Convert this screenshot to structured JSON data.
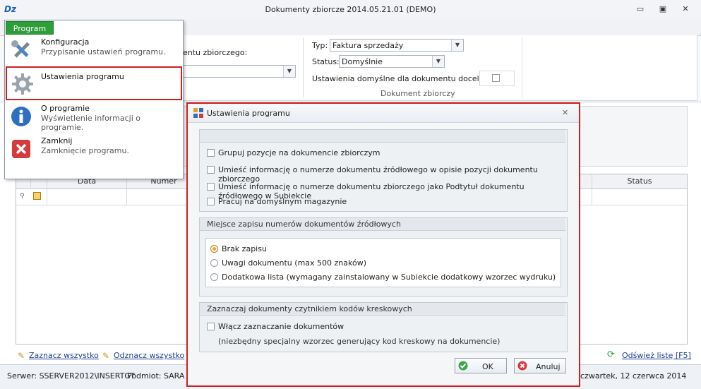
{
  "window": {
    "logo": "Dz",
    "title": "Dokumenty zbiorcze 2014.05.21.01 (DEMO)",
    "min_label": "▭",
    "restore_label": "▣",
    "close_label": "✕"
  },
  "ribbon": {
    "partial_label": "entu zbiorczego:",
    "typ_label": "Typ:",
    "typ_value": "Faktura sprzedaży",
    "status_label": "Status:",
    "status_value": "Domyślnie",
    "defaults_label": "Ustawienia domyślne dla dokumentu docelowego",
    "group_caption": "Dokument zbiorczy"
  },
  "grid": {
    "col_data": "Data",
    "col_numer": "Numer",
    "col_status": "Status"
  },
  "footer": {
    "select_all": "Zaznacz wszystko",
    "deselect_all": "Odznacz wszystko",
    "refresh": "Odśwież listę [F5]"
  },
  "statusbar": {
    "server": "Serwer: SSERVER2012\\INSERTGT",
    "entity": "Podmiot: SARA",
    "date": "czwartek, 12 czerwca 2014"
  },
  "program_menu": {
    "tab_label": "Program",
    "items": [
      {
        "title": "Konfiguracja",
        "desc": "Przypisanie ustawień programu.",
        "icon": "tools-icon"
      },
      {
        "title": "Ustawienia programu",
        "desc": "",
        "icon": "gear-icon"
      },
      {
        "title": "O programie",
        "desc": "Wyświetlenie informacji o programie.",
        "icon": "info-icon"
      },
      {
        "title": "Zamknij",
        "desc": "Zamknięcie programu.",
        "icon": "close-icon"
      }
    ]
  },
  "dialog": {
    "title": "Ustawienia programu",
    "close_label": "✕",
    "general": {
      "options": [
        "Grupuj pozycje na dokumencie zbiorczym",
        "Umieść informację o numerze dokumentu źródłowego w opisie pozycji dokumentu zbiorczego",
        "Umieść informację o numerze dokumentu zbiorczego jako Podtytuł dokumentu źródłowego w Subiekcie",
        "Pracuj na domyślnym magazynie"
      ]
    },
    "storage": {
      "header": "Miejsce zapisu numerów dokumentów źródłowych",
      "options": [
        "Brak zapisu",
        "Uwagi dokumentu (max 500 znaków)",
        "Dodatkowa lista (wymagany zainstalowany w Subiekcie dodatkowy wzorzec wydruku)"
      ],
      "selected": 0
    },
    "barcode": {
      "header": "Zaznaczaj dokumenty czytnikiem kodów kreskowych",
      "option": "Włącz zaznaczanie dokumentów",
      "note": "(niezbędny specjalny wzorzec generujący kod kreskowy na dokumencie)"
    },
    "ok_label": "OK",
    "cancel_label": "Anuluj"
  },
  "colors": {
    "highlight_red": "#d11f1f",
    "program_green": "#2e9e3a",
    "link_blue": "#1d3f8f"
  }
}
